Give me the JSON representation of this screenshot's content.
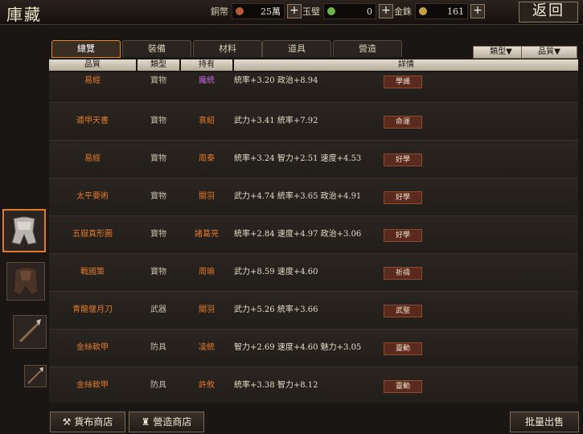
{
  "title": "庫藏",
  "currencies": [
    {
      "label": "銅幣",
      "value": "25萬",
      "coin_color": "#b45a34"
    },
    {
      "label": "玉璧",
      "value": "0",
      "coin_color": "#6fb24a"
    },
    {
      "label": "金銖",
      "value": "161",
      "coin_color": "#c8a040"
    }
  ],
  "back_label": "返回",
  "tabs": [
    "總覽",
    "裝備",
    "材料",
    "道具",
    "營造"
  ],
  "active_tab": 0,
  "filters": [
    "類型▼",
    "品質▼"
  ],
  "columns": [
    "品質",
    "類型",
    "持有",
    "詳情"
  ],
  "rows": [
    {
      "name": "易經",
      "type": "寶物",
      "owner": "龐統",
      "owner_color": "purple",
      "detail": "統率+3.20  政治+8.94",
      "badge": "學識"
    },
    {
      "name": "遁甲天書",
      "type": "寶物",
      "owner": "袁紹",
      "owner_color": "orange",
      "detail": "武力+3.41  統率+7.92",
      "badge": "命運"
    },
    {
      "name": "易經",
      "type": "寶物",
      "owner": "周泰",
      "owner_color": "orange",
      "detail": "統率+3.24  智力+2.51  速度+4.53",
      "badge": "好學"
    },
    {
      "name": "太平要術",
      "type": "寶物",
      "owner": "關羽",
      "owner_color": "orange",
      "detail": "武力+4.74  統率+3.65  政治+4.91",
      "badge": "好學"
    },
    {
      "name": "五嶽真形圖",
      "type": "寶物",
      "owner": "諸葛亮",
      "owner_color": "orange",
      "detail": "統率+2.84  速度+4.97  政治+3.06",
      "badge": "好學"
    },
    {
      "name": "戰國策",
      "type": "寶物",
      "owner": "周瑜",
      "owner_color": "orange",
      "detail": "武力+8.59  速度+4.60",
      "badge": "祈禱"
    },
    {
      "name": "青龍偃月刀",
      "type": "武器",
      "owner": "關羽",
      "owner_color": "orange",
      "detail": "武力+5.26  統率+3.66",
      "badge": "武聖"
    },
    {
      "name": "金絲軟甲",
      "type": "防具",
      "owner": "凌統",
      "owner_color": "orange",
      "detail": "智力+2.69  速度+4.60  魅力+3.05",
      "badge": "靈動"
    },
    {
      "name": "金絲軟甲",
      "type": "防具",
      "owner": "許攸",
      "owner_color": "orange",
      "detail": "統率+3.38  智力+8.12",
      "badge": "靈動"
    }
  ],
  "sidebar_icons": [
    "armor-icon",
    "robe-icon",
    "spear-icon",
    "halberd-icon"
  ],
  "bottom_buttons": [
    "貨布商店",
    "營造商店",
    "批量出售"
  ]
}
